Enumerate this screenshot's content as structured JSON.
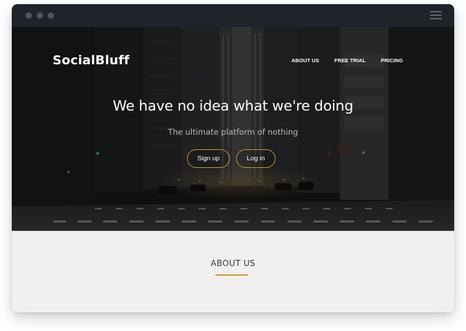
{
  "brand": {
    "name": "SocialBluff",
    "accent_color": "#d79a2b"
  },
  "window": {
    "chrome_color": "#1e2429",
    "menu_icon": "hamburger-icon"
  },
  "nav": {
    "items": [
      {
        "label": "ABOUT US"
      },
      {
        "label": "FREE TRIAL"
      },
      {
        "label": "PRICING"
      }
    ]
  },
  "hero": {
    "headline": "We have no idea what we're doing",
    "subheadline": "The ultimate platform of nothing",
    "background": "night-city-street-photo",
    "buttons": {
      "signup": "Sign up",
      "login": "Log in"
    }
  },
  "about": {
    "title": "ABOUT US"
  }
}
